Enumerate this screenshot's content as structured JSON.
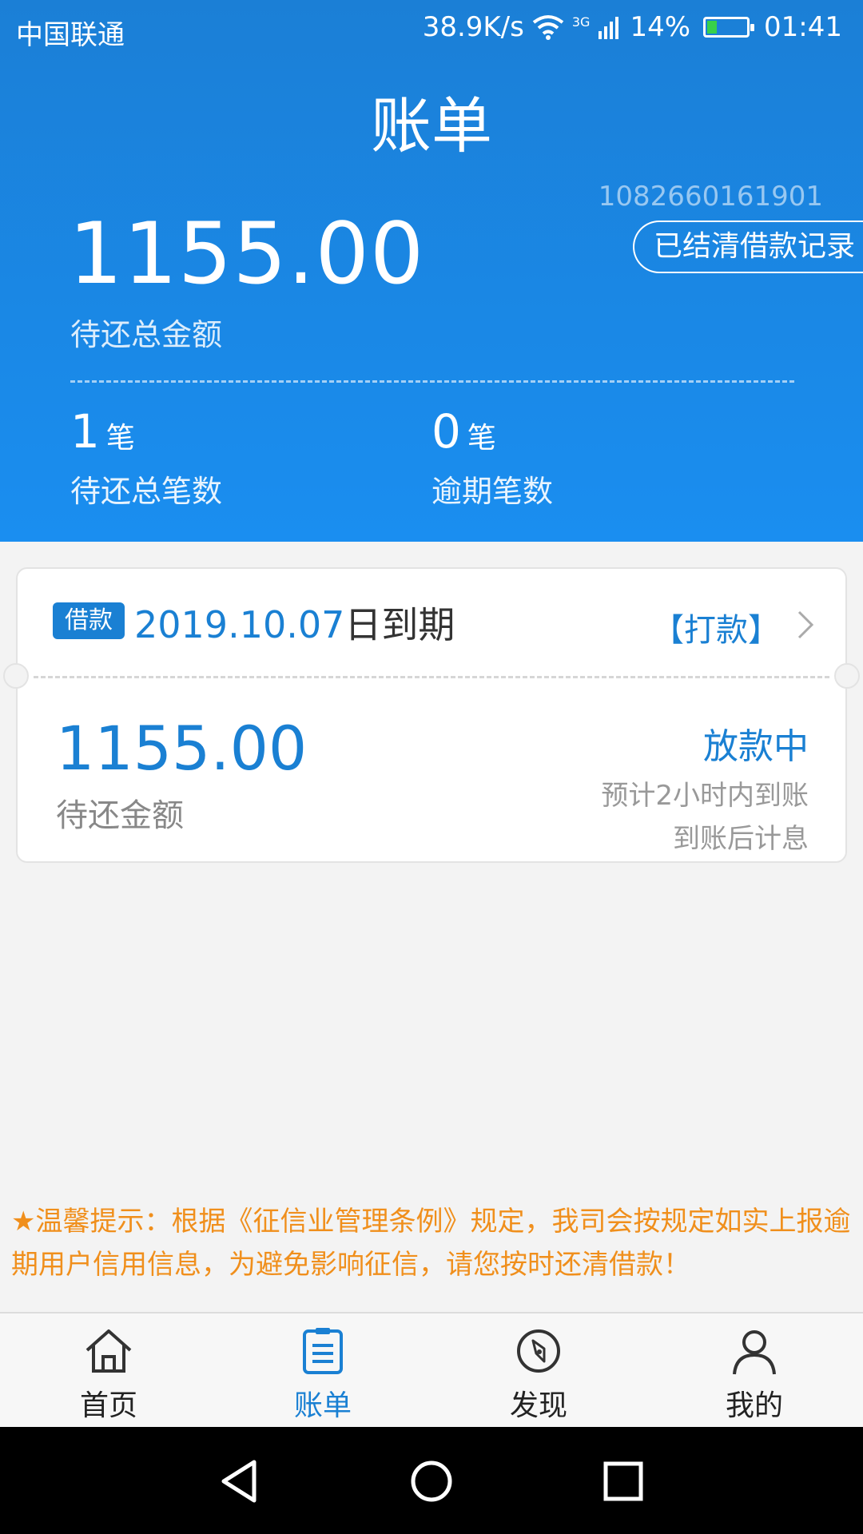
{
  "status_bar": {
    "carrier": "中国联通",
    "speed": "38.9K/s",
    "network": "3G",
    "battery": "14%",
    "time": "01:41"
  },
  "header": {
    "title": "账单",
    "account_id": "1082660161901",
    "settled_button": "已结清借款记录",
    "total_amount": "1155.00",
    "total_label": "待还总金额",
    "stats": [
      {
        "num": "1",
        "unit": "笔",
        "label": "待还总笔数"
      },
      {
        "num": "0",
        "unit": "笔",
        "label": "逾期笔数"
      }
    ]
  },
  "loan_card": {
    "tag": "借款",
    "due_date": "2019.10.07",
    "due_suffix": "日到期",
    "pay_link": "【打款】",
    "amount": "1155.00",
    "amount_label": "待还金额",
    "status": "放款中",
    "note1": "预计2小时内到账",
    "note2": "到账后计息"
  },
  "tip": "★温馨提示：根据《征信业管理条例》规定，我司会按规定如实上报逾期用户信用信息，为避免影响征信，请您按时还清借款！",
  "tabs": [
    {
      "label": "首页",
      "icon": "home-icon"
    },
    {
      "label": "账单",
      "icon": "bill-icon"
    },
    {
      "label": "发现",
      "icon": "compass-icon"
    },
    {
      "label": "我的",
      "icon": "user-icon"
    }
  ],
  "colors": {
    "primary": "#1a80d3",
    "tip": "#f08f1c",
    "header_top": "#1b7fd6"
  }
}
